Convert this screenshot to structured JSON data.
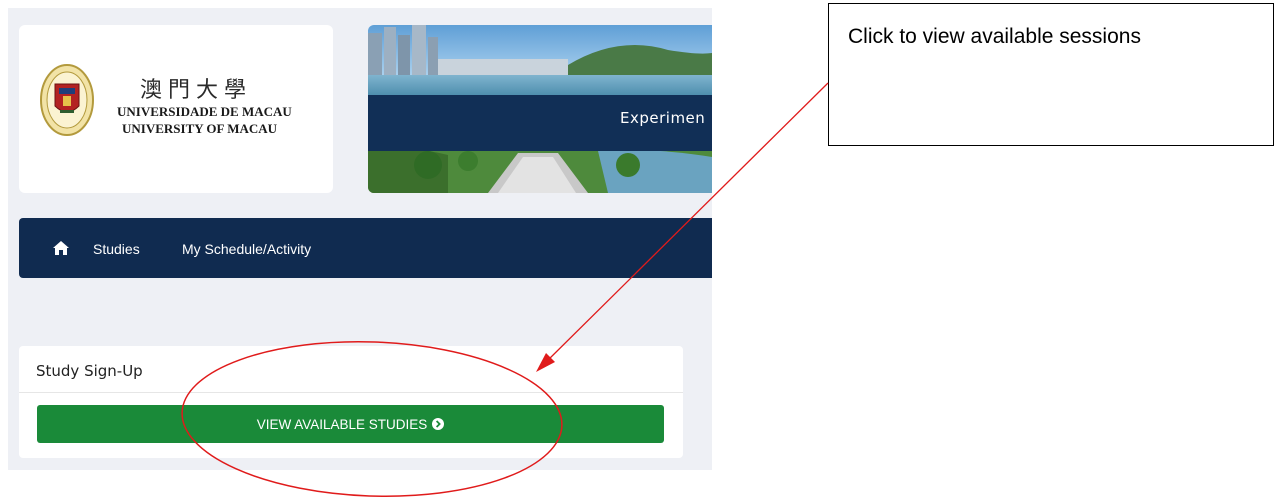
{
  "logo": {
    "chinese_name": "澳門大學",
    "portuguese_name": "UNIVERSIDADE DE MACAU",
    "english_name": "UNIVERSITY OF MACAU",
    "seal_icon": "university-seal-icon"
  },
  "banner": {
    "caption": "Experimen"
  },
  "nav": {
    "home_icon": "home-icon",
    "items": [
      {
        "label": "Studies"
      },
      {
        "label": "My Schedule/Activity"
      }
    ]
  },
  "study_signup": {
    "title": "Study Sign-Up",
    "button_label": "VIEW AVAILABLE STUDIES",
    "button_icon": "chevron-circle-right-icon"
  },
  "annotation": {
    "callout_text": "Click to view available sessions",
    "arrow_color": "#e01b1b",
    "ellipse_color": "#e01b1b"
  },
  "colors": {
    "navbar": "#102b50",
    "button": "#1a8a39",
    "page_background": "#eef0f5"
  }
}
